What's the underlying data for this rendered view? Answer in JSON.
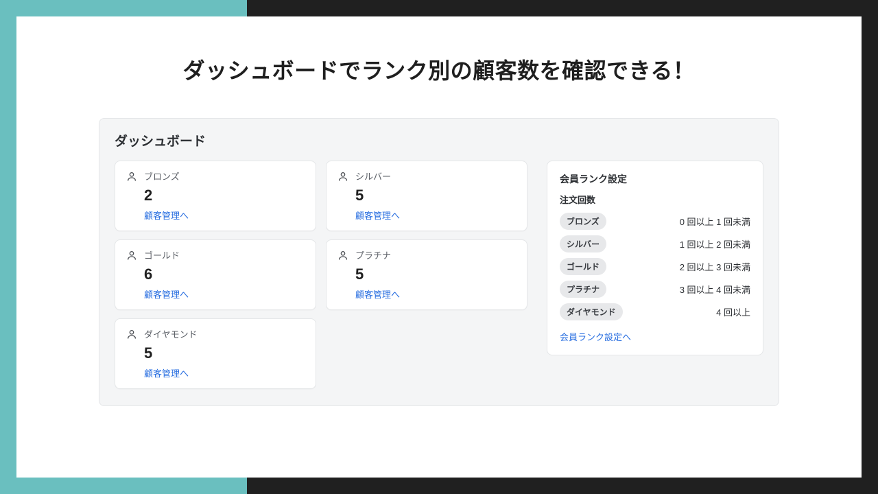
{
  "headline": "ダッシュボードでランク別の顧客数を確認できる！",
  "dashboard": {
    "title": "ダッシュボード",
    "link_label": "顧客管理へ",
    "cardsA": [
      {
        "name": "ブロンズ",
        "value": "2"
      },
      {
        "name": "ゴールド",
        "value": "6"
      },
      {
        "name": "ダイヤモンド",
        "value": "5"
      }
    ],
    "cardsB": [
      {
        "name": "シルバー",
        "value": "5"
      },
      {
        "name": "プラチナ",
        "value": "5"
      }
    ]
  },
  "settings": {
    "title": "会員ランク設定",
    "subtitle": "注文回数",
    "rows": [
      {
        "badge": "ブロンズ",
        "rule": "0 回以上 1 回未満"
      },
      {
        "badge": "シルバー",
        "rule": "1 回以上 2 回未満"
      },
      {
        "badge": "ゴールド",
        "rule": "2 回以上 3 回未満"
      },
      {
        "badge": "プラチナ",
        "rule": "3 回以上 4 回未満"
      },
      {
        "badge": "ダイヤモンド",
        "rule": "4 回以上"
      }
    ],
    "link_label": "会員ランク設定へ"
  }
}
